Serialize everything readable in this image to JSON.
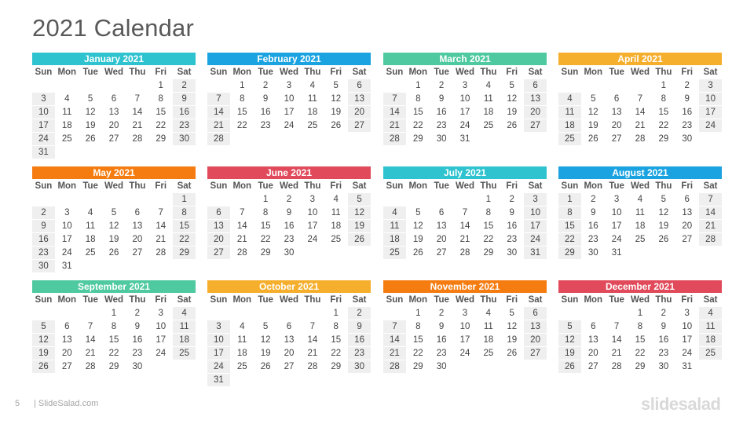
{
  "title": "2021 Calendar",
  "weekdays": [
    "Sun",
    "Mon",
    "Tue",
    "Wed",
    "Thu",
    "Fri",
    "Sat"
  ],
  "months": [
    {
      "name": "January 2021",
      "color": "#2ec3cf",
      "start": 5,
      "days": 31
    },
    {
      "name": "February 2021",
      "color": "#1aa3e0",
      "start": 1,
      "days": 28
    },
    {
      "name": "March 2021",
      "color": "#4ec9a0",
      "start": 1,
      "days": 31
    },
    {
      "name": "April 2021",
      "color": "#f6ae2d",
      "start": 4,
      "days": 30
    },
    {
      "name": "May 2021",
      "color": "#f57c10",
      "start": 6,
      "days": 31
    },
    {
      "name": "June 2021",
      "color": "#e04a5a",
      "start": 2,
      "days": 30
    },
    {
      "name": "July 2021",
      "color": "#2ec3cf",
      "start": 4,
      "days": 31
    },
    {
      "name": "August 2021",
      "color": "#1aa3e0",
      "start": 0,
      "days": 31
    },
    {
      "name": "September 2021",
      "color": "#4ec9a0",
      "start": 3,
      "days": 30
    },
    {
      "name": "October 2021",
      "color": "#f6ae2d",
      "start": 5,
      "days": 31
    },
    {
      "name": "November 2021",
      "color": "#f57c10",
      "start": 1,
      "days": 30
    },
    {
      "name": "December 2021",
      "color": "#e04a5a",
      "start": 3,
      "days": 31
    }
  ],
  "footer": {
    "page_number": "5",
    "site": "| SlideSalad.com",
    "brand": "slidesalad"
  }
}
